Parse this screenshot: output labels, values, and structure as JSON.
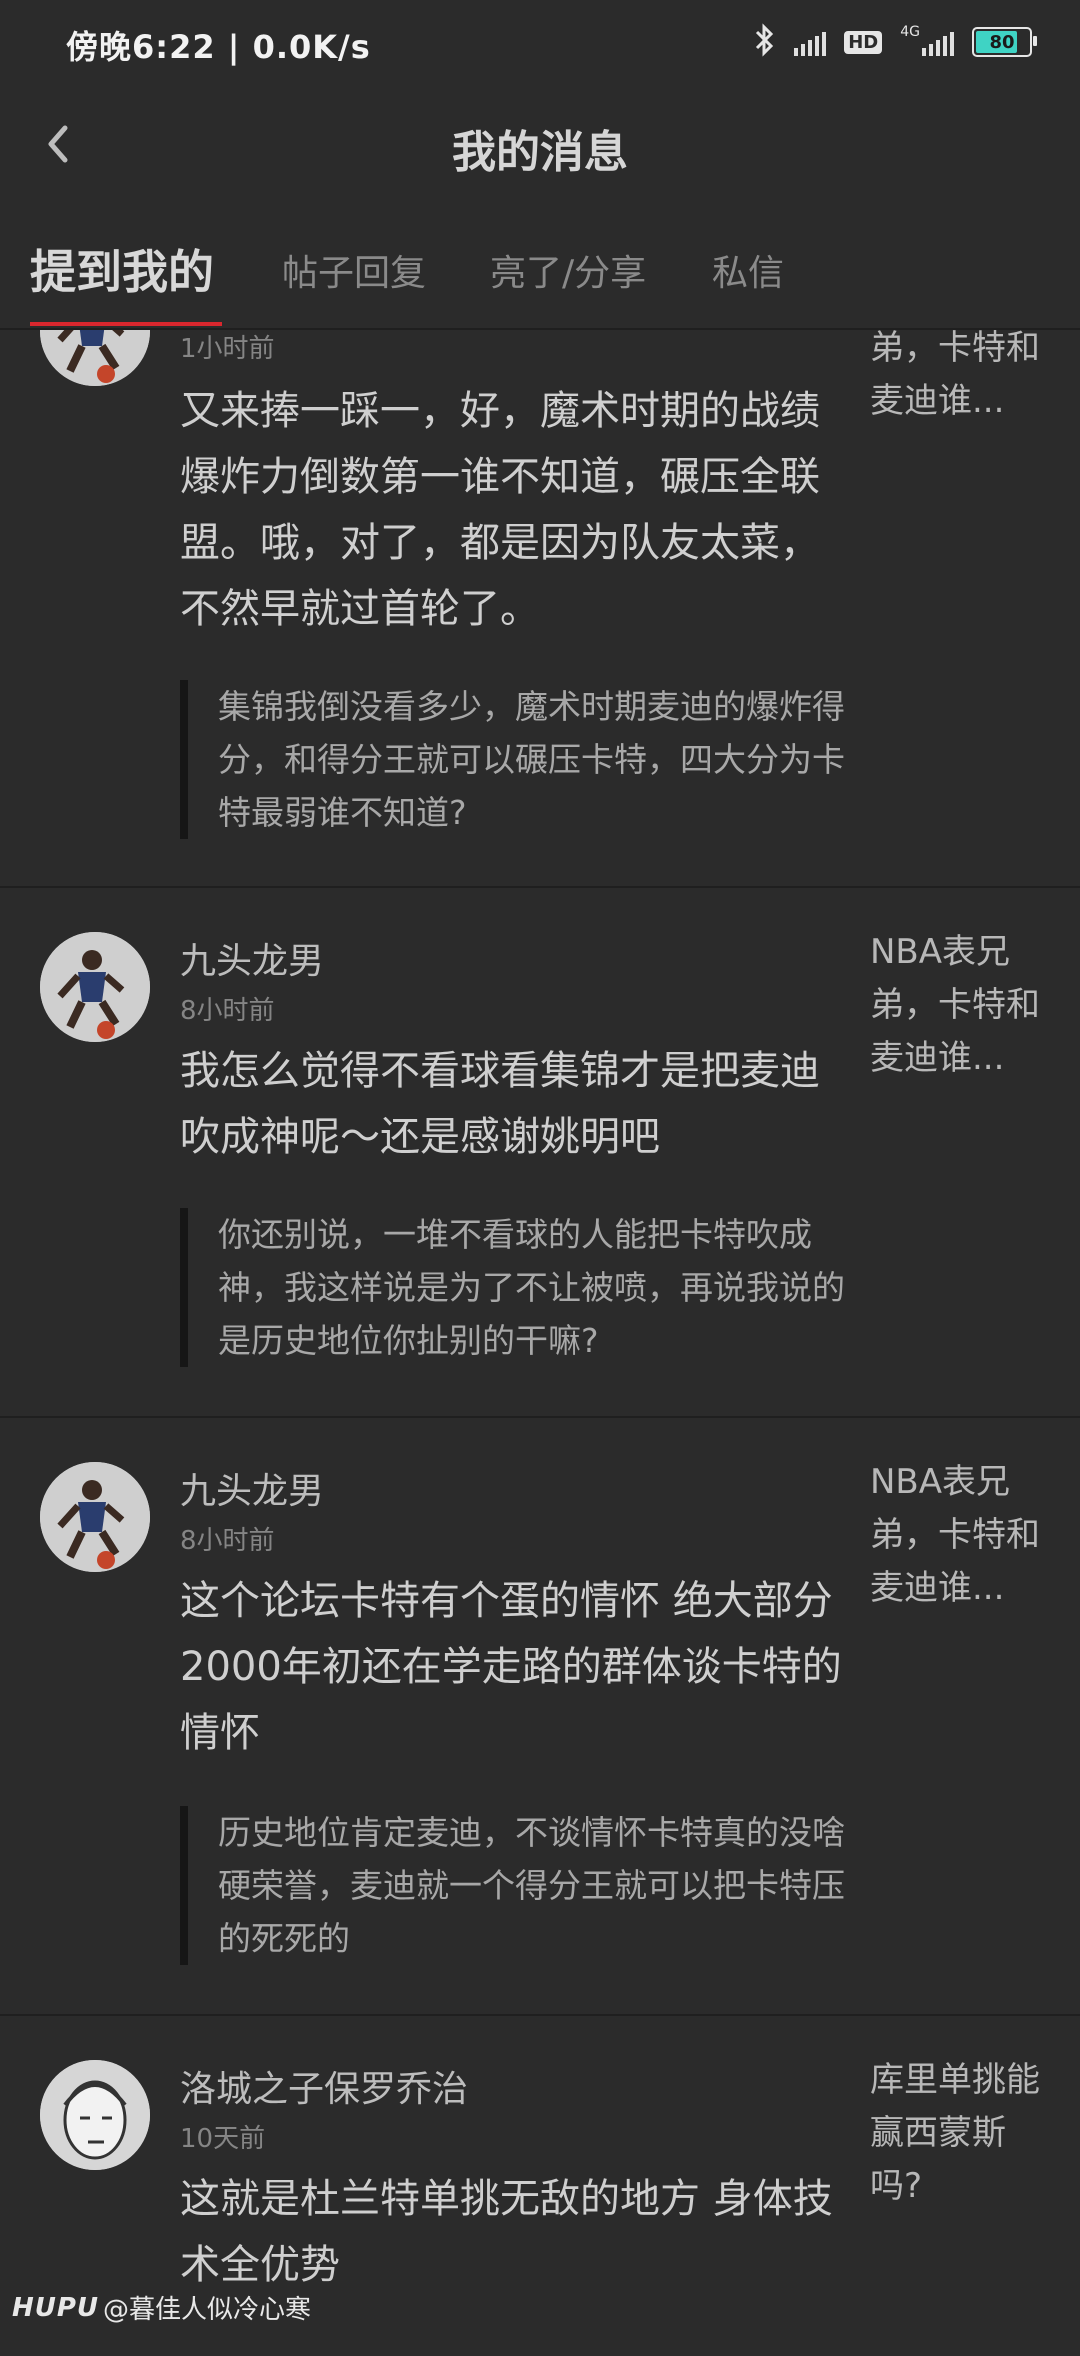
{
  "status_bar": {
    "left_text": "傍晚6:22 | 0.0K/s",
    "network": "4G",
    "hd": "HD",
    "battery": "80",
    "battery_level": 0.8
  },
  "header": {
    "title": "我的消息"
  },
  "tabs": [
    {
      "label": "提到我的",
      "active": true
    },
    {
      "label": "帖子回复",
      "active": false
    },
    {
      "label": "亮了/分享",
      "active": false
    },
    {
      "label": "私信",
      "active": false
    }
  ],
  "messages": [
    {
      "username": "",
      "time": "1小时前",
      "text": "又来捧一踩一，好，魔术时期的战绩爆炸力倒数第一谁不知道，碾压全联盟。哦，对了，都是因为队友太菜，不然早就过首轮了。",
      "quote": "集锦我倒没看多少，魔术时期麦迪的爆炸得分，和得分王就可以碾压卡特，四大分为卡特最弱谁不知道?",
      "thread": "弟，卡特和麦迪谁..."
    },
    {
      "username": "九头龙男",
      "time": "8小时前",
      "text": "我怎么觉得不看球看集锦才是把麦迪吹成神呢～还是感谢姚明吧",
      "quote": "你还别说，一堆不看球的人能把卡特吹成神，我这样说是为了不让被喷，再说我说的是历史地位你扯别的干嘛?",
      "thread": "NBA表兄弟，卡特和麦迪谁..."
    },
    {
      "username": "九头龙男",
      "time": "8小时前",
      "text": "这个论坛卡特有个蛋的情怀 绝大部分2000年初还在学走路的群体谈卡特的情怀",
      "quote": "历史地位肯定麦迪，不谈情怀卡特真的没啥硬荣誉，麦迪就一个得分王就可以把卡特压的死死的",
      "thread": "NBA表兄弟，卡特和麦迪谁..."
    },
    {
      "username": "洛城之子保罗乔治",
      "time": "10天前",
      "text": "这就是杜兰特单挑无敌的地方 身体技术全优势",
      "quote": "",
      "thread": "库里单挑能赢西蒙斯吗?"
    }
  ],
  "watermark": {
    "brand": "HUPU",
    "text": "@暮佳人似冷心寒"
  }
}
